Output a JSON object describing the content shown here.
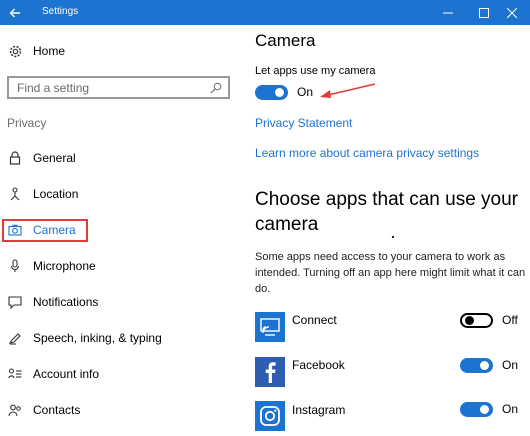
{
  "window": {
    "title": "Settings"
  },
  "sidebar": {
    "home_label": "Home",
    "search_placeholder": "Find a setting",
    "section_label": "Privacy",
    "items": [
      {
        "label": "General",
        "icon": "lock-icon"
      },
      {
        "label": "Location",
        "icon": "location-person-icon"
      },
      {
        "label": "Camera",
        "icon": "camera-icon",
        "selected": true
      },
      {
        "label": "Microphone",
        "icon": "microphone-icon"
      },
      {
        "label": "Notifications",
        "icon": "notifications-icon"
      },
      {
        "label": "Speech, inking, & typing",
        "icon": "speech-icon"
      },
      {
        "label": "Account info",
        "icon": "account-info-icon"
      },
      {
        "label": "Contacts",
        "icon": "contacts-icon"
      }
    ]
  },
  "main": {
    "title": "Camera",
    "toggle_label": "Let apps use my camera",
    "toggle_state": "On",
    "privacy_link": "Privacy Statement",
    "learn_more_link": "Learn more about camera privacy settings",
    "choose_heading": "Choose apps that can use your camera",
    "description": "Some apps need access to your camera to work as intended. Turning off an app here might limit what it can do.",
    "apps": [
      {
        "name": "Connect",
        "state": "Off",
        "icon": "connect-icon"
      },
      {
        "name": "Facebook",
        "state": "On",
        "icon": "facebook-icon"
      },
      {
        "name": "Instagram",
        "state": "On",
        "icon": "instagram-icon"
      }
    ]
  },
  "colors": {
    "accent": "#1d73d0",
    "highlight": "#e03a3a"
  }
}
